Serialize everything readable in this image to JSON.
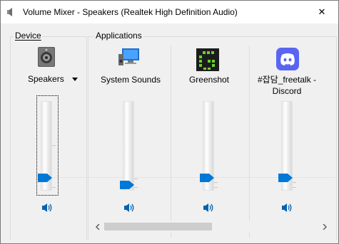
{
  "window": {
    "title": "Volume Mixer - Speakers (Realtek High Definition Audio)",
    "close_symbol": "✕"
  },
  "device": {
    "group_label": "Device",
    "name": "Speakers",
    "icon": "speaker-device-icon",
    "volume_fraction": 0.1
  },
  "applications": {
    "group_label": "Applications",
    "items": [
      {
        "name": "System Sounds",
        "icon": "system-sounds-icon",
        "volume_fraction": 0.0
      },
      {
        "name": "Greenshot",
        "icon": "greenshot-icon",
        "volume_fraction": 0.1
      },
      {
        "name": "#잡담_freetalk - Discord",
        "icon": "discord-icon",
        "volume_fraction": 0.1
      }
    ]
  },
  "colors": {
    "accent": "#0078d7",
    "greenshot_bg": "#1c1c1c",
    "greenshot_fg": "#6ad12e",
    "discord": "#5865f2"
  }
}
